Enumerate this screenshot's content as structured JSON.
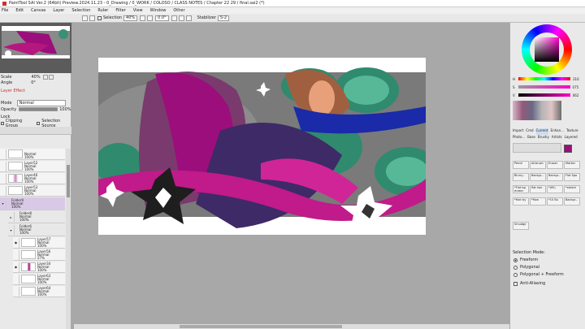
{
  "window": {
    "title": "PaintTool SAI Ver.2 (64bit) Preview.2024.11.23 - 0_Drawing / 0_WORK / COLOSO / CLASS NOTES / Chapter 22 29 / final.sai2 (*)"
  },
  "menu": [
    "File",
    "Edit",
    "Canvas",
    "Layer",
    "Selection",
    "Ruler",
    "Filter",
    "View",
    "Window",
    "Other"
  ],
  "toolbar": {
    "selection_label": "Selection",
    "zoom": "40%",
    "angle": "0.0°",
    "stabilizer_label": "Stabilizer",
    "stabilizer_value": "S-2"
  },
  "navigator": {
    "scale_label": "Scale",
    "scale_value": "40%",
    "angle_label": "Angle",
    "angle_value": "0°"
  },
  "layer_props": {
    "layer_effect": "Layer Effect",
    "mode_label": "Mode",
    "mode_value": "Normal",
    "opacity_label": "Opacity",
    "opacity_value": "100%",
    "lock_label": "Lock",
    "clipping_group": "Clipping Group",
    "selection_source": "Selection Source"
  },
  "layers": [
    {
      "name": "",
      "mode": "Normal",
      "opacity": "100%"
    },
    {
      "name": "Layer52",
      "mode": "Normal",
      "opacity": "100%"
    },
    {
      "name": "Layer46",
      "mode": "Normal",
      "opacity": "100%"
    },
    {
      "name": "Layer53",
      "mode": "Normal",
      "opacity": "100%"
    },
    {
      "name": "Folder9",
      "mode": "Normal",
      "opacity": "100%"
    },
    {
      "name": "Folder8",
      "mode": "Normal",
      "opacity": "100%"
    },
    {
      "name": "Folder6",
      "mode": "Normal",
      "opacity": "100%"
    },
    {
      "name": "Layer57",
      "mode": "Normal",
      "opacity": "100%"
    },
    {
      "name": "Layer56",
      "mode": "Normal",
      "opacity": "27%"
    },
    {
      "name": "Layer34",
      "mode": "Normal",
      "opacity": "100%"
    },
    {
      "name": "Layer63",
      "mode": "Normal",
      "opacity": "100%"
    },
    {
      "name": "Layer64",
      "mode": "Normal",
      "opacity": "100%"
    }
  ],
  "color": {
    "current": "#9b0e7c",
    "h_label": "H",
    "h_value": "316",
    "s_label": "S",
    "s_value": "075",
    "v_label": "V",
    "v_value": "062"
  },
  "tabs": [
    "Import",
    "Cmd",
    "Current",
    "Enhan...",
    "Texture",
    "Photo...",
    "Base",
    "Brushy",
    "Artists",
    "Layered"
  ],
  "tools": [
    "Pencil",
    "Airbrush",
    "Eraser",
    "Marker",
    "Blurry...",
    "Backgr...",
    "Backgr...",
    "Flat Spo",
    "*Flat bg eraser",
    "flat hair",
    "*(fill)",
    "*sketch",
    "*Hair by",
    "*flow",
    "*10 Bu",
    "Backgr...",
    "Smudge"
  ],
  "selection_mode": {
    "title": "Selection Mode:",
    "options": [
      "Freeform",
      "Polygonal",
      "Polygonal + Freeform"
    ],
    "selected": "Freeform",
    "anti_aliasing": "Anti-Aliasing"
  }
}
